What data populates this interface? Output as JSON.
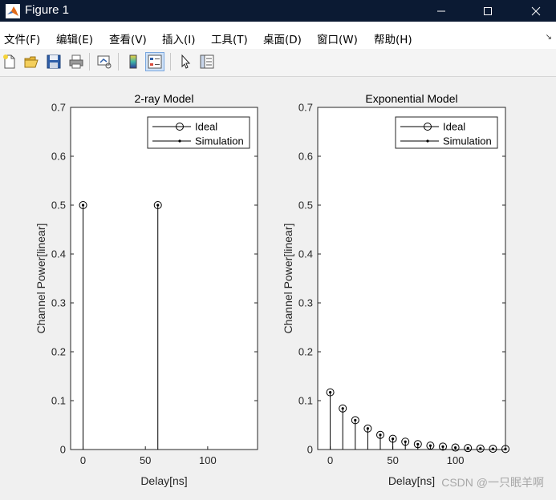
{
  "window": {
    "title": "Figure 1",
    "controls": [
      "minimize",
      "maximize",
      "close"
    ]
  },
  "menu": {
    "items": [
      "文件(F)",
      "编辑(E)",
      "查看(V)",
      "插入(I)",
      "工具(T)",
      "桌面(D)",
      "窗口(W)",
      "帮助(H)"
    ],
    "corner_glyph": "↘"
  },
  "toolbar": {
    "buttons": [
      "new-figure-icon",
      "open-file-icon",
      "save-icon",
      "print-icon",
      "link-plot-icon",
      "insert-colorbar-icon",
      "insert-legend-icon",
      "pointer-icon",
      "property-inspector-icon"
    ]
  },
  "watermark": "CSDN @一只眠羊啊",
  "colors": {
    "titlebar": "#0b1a33",
    "plot_line": "#000000",
    "plot_bg": "#ffffff",
    "figure_bg": "#f0f0f0"
  },
  "chart_data": [
    {
      "type": "stem",
      "title": "2-ray Model",
      "xlabel": "Delay[ns]",
      "ylabel": "Channel Power[linear]",
      "xlim": [
        -10,
        140
      ],
      "ylim": [
        0,
        0.7
      ],
      "xticks": [
        0,
        50,
        100
      ],
      "yticks": [
        0,
        0.1,
        0.2,
        0.3,
        0.4,
        0.5,
        0.6,
        0.7
      ],
      "ytick_labels": [
        "0",
        "0.1",
        "0.2",
        "0.3",
        "0.4",
        "0.5",
        "0.6",
        "0.7"
      ],
      "legend": {
        "position": "top-right",
        "entries": [
          "Ideal",
          "Simulation"
        ]
      },
      "grid": false,
      "series": [
        {
          "name": "Ideal",
          "marker": "circle",
          "x": [
            0,
            60
          ],
          "y": [
            0.5,
            0.5
          ]
        },
        {
          "name": "Simulation",
          "marker": "dot",
          "x": [
            0,
            60
          ],
          "y": [
            0.5,
            0.5
          ]
        }
      ]
    },
    {
      "type": "stem",
      "title": "Exponential Model",
      "xlabel": "Delay[ns]",
      "ylabel": "Channel Power[linear]",
      "xlim": [
        -10,
        140
      ],
      "ylim": [
        0,
        0.7
      ],
      "xticks": [
        0,
        50,
        100
      ],
      "yticks": [
        0,
        0.1,
        0.2,
        0.3,
        0.4,
        0.5,
        0.6,
        0.7
      ],
      "ytick_labels": [
        "0",
        "0.1",
        "0.2",
        "0.3",
        "0.4",
        "0.5",
        "0.6",
        "0.7"
      ],
      "legend": {
        "position": "top-right",
        "entries": [
          "Ideal",
          "Simulation"
        ]
      },
      "grid": false,
      "series": [
        {
          "name": "Ideal",
          "marker": "circle",
          "x": [
            0,
            10,
            20,
            30,
            40,
            50,
            60,
            70,
            80,
            90,
            100,
            110,
            120,
            130,
            140
          ],
          "y": [
            0.117,
            0.084,
            0.06,
            0.043,
            0.03,
            0.022,
            0.016,
            0.011,
            0.008,
            0.006,
            0.004,
            0.003,
            0.002,
            0.0015,
            0.001
          ]
        },
        {
          "name": "Simulation",
          "marker": "dot",
          "x": [
            0,
            10,
            20,
            30,
            40,
            50,
            60,
            70,
            80,
            90,
            100,
            110,
            120,
            130,
            140
          ],
          "y": [
            0.117,
            0.084,
            0.06,
            0.043,
            0.03,
            0.022,
            0.016,
            0.011,
            0.008,
            0.006,
            0.004,
            0.003,
            0.002,
            0.0015,
            0.001
          ]
        }
      ]
    }
  ]
}
